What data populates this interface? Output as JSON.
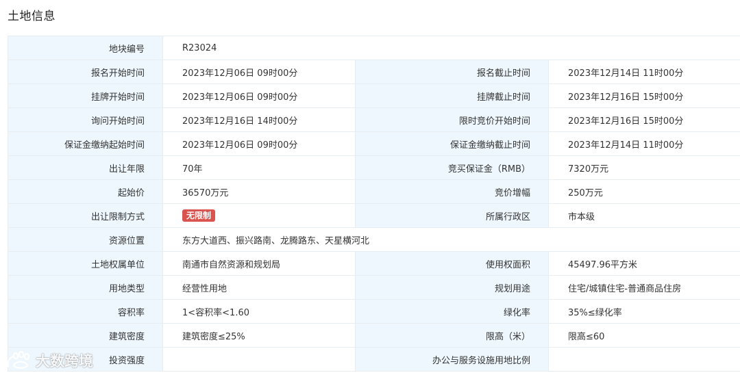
{
  "section_title": "土地信息",
  "rows": [
    {
      "l1": "地块编号",
      "v1": "R23024"
    },
    {
      "l1": "报名开始时间",
      "v1": "2023年12月06日 09时00分",
      "l2": "报名截止时间",
      "v2": "2023年12月14日 11时00分"
    },
    {
      "l1": "挂牌开始时间",
      "v1": "2023年12月06日 09时00分",
      "l2": "挂牌截止时间",
      "v2": "2023年12月16日 15时00分"
    },
    {
      "l1": "询问开始时间",
      "v1": "2023年12月16日 14时00分",
      "l2": "限时竞价开始时间",
      "v2": "2023年12月16日 15时00分"
    },
    {
      "l1": "保证金缴纳起始时间",
      "v1": "2023年12月06日 09时00分",
      "l2": "保证金缴纳截止时间",
      "v2": "2023年12月14日 11时00分"
    },
    {
      "l1": "出让年限",
      "v1": "70年",
      "l2": "竞买保证金（RMB）",
      "v2": "7320万元"
    },
    {
      "l1": "起始价",
      "v1": "36570万元",
      "l2": "竞价增幅",
      "v2": "250万元"
    },
    {
      "l1": "出让限制方式",
      "badge": "无限制",
      "l2": "所属行政区",
      "v2": "市本级"
    },
    {
      "l1": "资源位置",
      "v1": "东方大道西、振兴路南、龙腾路东、天星横河北"
    },
    {
      "l1": "土地权属单位",
      "v1": "南通市自然资源和规划局",
      "l2": "使用权面积",
      "v2": "45497.96平方米"
    },
    {
      "l1": "用地类型",
      "v1": "经营性用地",
      "l2": "规划用途",
      "v2": "住宅/城镇住宅-普通商品住房"
    },
    {
      "l1": "容积率",
      "v1": "1<容积率<1.60",
      "l2": "绿化率",
      "v2": "35%≤绿化率"
    },
    {
      "l1": "建筑密度",
      "v1": "建筑密度≤25%",
      "l2": "限高（米）",
      "v2": "限高≤60"
    },
    {
      "l1": "投资强度",
      "v1": "",
      "l2": "办公与服务设施用地比例",
      "v2": ""
    }
  ],
  "watermark": {
    "text": "大数跨境",
    "icon": "paw-logo-icon"
  },
  "colors": {
    "label_bg": "#eef7fd",
    "border": "#e8edf2",
    "badge_bg": "#d9534f"
  }
}
